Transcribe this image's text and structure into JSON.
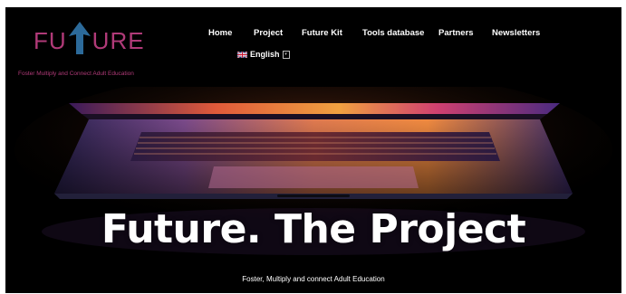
{
  "logo": {
    "prefix": "FU",
    "suffix": "URE",
    "tagline": "Foster Multiply and Connect Adult Education",
    "color": "#b03a78",
    "arrow_color": "#2c6a9a"
  },
  "nav": {
    "items": [
      "Home",
      "Project",
      "Future Kit",
      "Tools database",
      "Partners",
      "Newsletters"
    ]
  },
  "language": {
    "current": "English",
    "icon": "uk-flag-icon"
  },
  "hero": {
    "title": "Future. The Project",
    "subtitle": "Foster, Multiply and connect Adult Education",
    "image": "laptop-photo"
  }
}
